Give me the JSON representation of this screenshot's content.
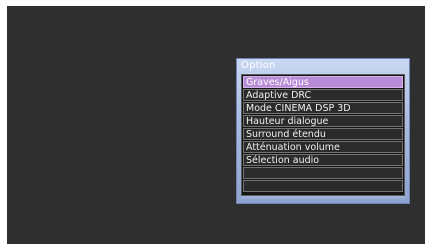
{
  "menu": {
    "title": "Option",
    "items": [
      {
        "label": "Graves/Aigus",
        "selected": true
      },
      {
        "label": "Adaptive DRC",
        "selected": false
      },
      {
        "label": "Mode CINEMA DSP 3D",
        "selected": false
      },
      {
        "label": "Hauteur dialogue",
        "selected": false
      },
      {
        "label": "Surround étendu",
        "selected": false
      },
      {
        "label": "Atténuation volume",
        "selected": false
      },
      {
        "label": "Sélection audio",
        "selected": false
      },
      {
        "label": "",
        "selected": false
      },
      {
        "label": "",
        "selected": false
      }
    ]
  },
  "colors": {
    "background": "#2f2f2f",
    "menu_frame": "#a8bbe0",
    "selected_item": "#b78bd6"
  }
}
